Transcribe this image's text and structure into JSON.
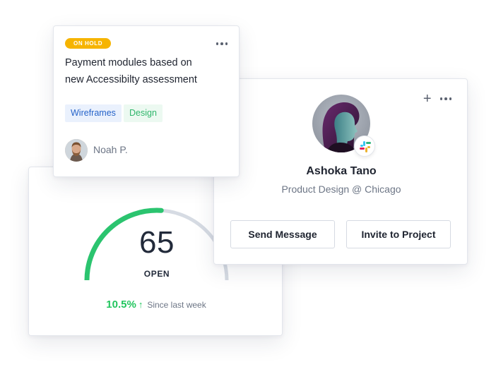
{
  "task_card": {
    "status": "ON HOLD",
    "title_line1": "Payment modules based on",
    "title_line2": "new Accessibilty assessment",
    "tags": [
      "Wireframes",
      "Design"
    ],
    "assignee": "Noah P."
  },
  "stats_card": {
    "value": "65",
    "label": "OPEN",
    "progress_fraction": 0.52,
    "trend_percent": "10.5%",
    "trend_arrow": "↑",
    "trend_note": "Since last week"
  },
  "profile_card": {
    "name": "Ashoka Tano",
    "role": "Product Design @ Chicago",
    "send_button": "Send Message",
    "invite_button": "Invite to Project",
    "add_icon": "+"
  },
  "colors": {
    "gauge_green": "#2bc46f",
    "gauge_track": "#d6dbe3",
    "trend_green": "#22c55e",
    "badge_amber": "#f6b400",
    "tag_blue_text": "#2563c9",
    "tag_green_text": "#2fb66b"
  },
  "icons": {
    "more": "more-dots-icon",
    "add": "plus-icon",
    "trend": "arrow-up-icon",
    "integration": "slack-logo-icon"
  }
}
